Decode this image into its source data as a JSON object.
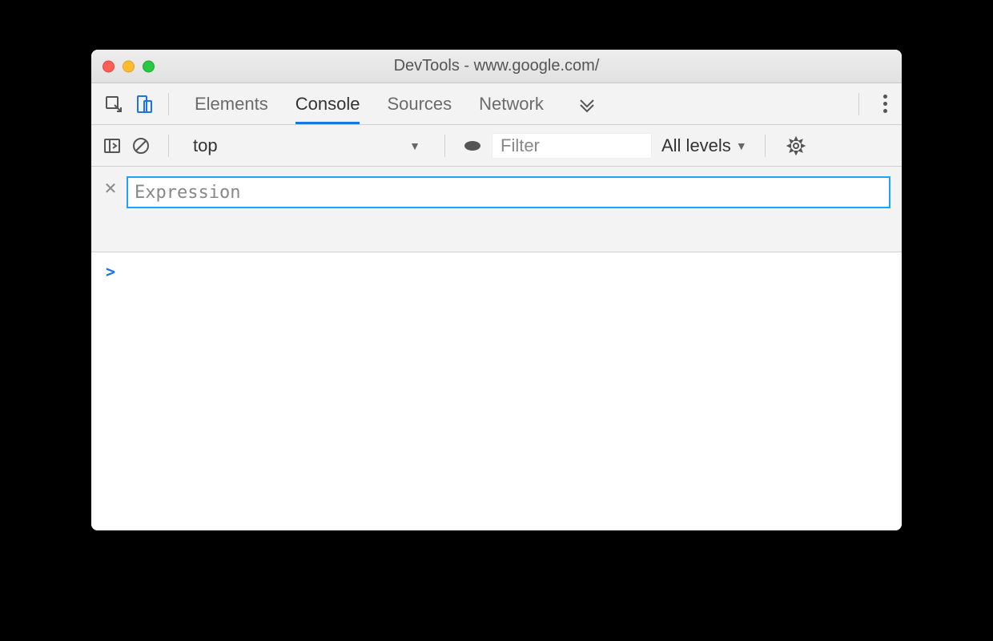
{
  "window": {
    "title": "DevTools - www.google.com/"
  },
  "tabs": {
    "items": [
      "Elements",
      "Console",
      "Sources",
      "Network"
    ],
    "active_index": 1
  },
  "console_toolbar": {
    "context": "top",
    "filter_placeholder": "Filter",
    "filter_value": "",
    "levels_label": "All levels"
  },
  "live_expression": {
    "placeholder": "Expression",
    "value": ""
  },
  "console": {
    "prompt": ">"
  }
}
